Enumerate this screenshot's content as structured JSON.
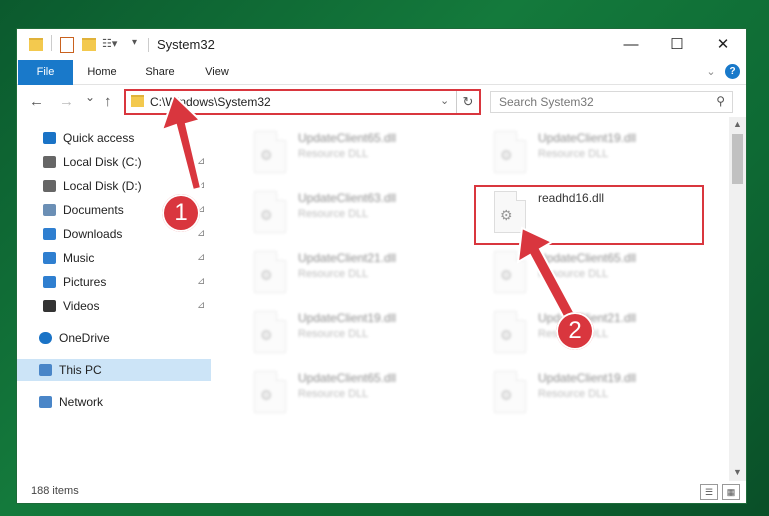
{
  "window": {
    "title": "System32",
    "controls": {
      "minimize": "—",
      "maximize": "☐",
      "close": "✕"
    }
  },
  "ribbon": {
    "tabs": [
      "File",
      "Home",
      "Share",
      "View"
    ],
    "expand_icon": "chevron-down-icon",
    "help_icon": "?"
  },
  "nav": {
    "back": "←",
    "forward": "→",
    "recent": "⌄",
    "up": "↑",
    "address": "C:\\Windows\\System32",
    "dropdown": "⌄",
    "refresh": "↻",
    "search_placeholder": "Search System32",
    "search_icon": "⚲"
  },
  "sidebar": {
    "items": [
      {
        "label": "Quick access",
        "icon": "star-icon",
        "pin": false
      },
      {
        "label": "Local Disk (C:)",
        "icon": "drive-icon",
        "pin": true
      },
      {
        "label": "Local Disk (D:)",
        "icon": "drive-icon",
        "pin": true
      },
      {
        "label": "Documents",
        "icon": "documents-icon",
        "pin": true
      },
      {
        "label": "Downloads",
        "icon": "download-icon",
        "pin": true
      },
      {
        "label": "Music",
        "icon": "music-icon",
        "pin": true
      },
      {
        "label": "Pictures",
        "icon": "pictures-icon",
        "pin": true
      },
      {
        "label": "Videos",
        "icon": "videos-icon",
        "pin": true
      },
      {
        "label": "OneDrive",
        "icon": "cloud-icon",
        "pin": false
      },
      {
        "label": "This PC",
        "icon": "computer-icon",
        "pin": false,
        "selected": true
      },
      {
        "label": "Network",
        "icon": "network-icon",
        "pin": false
      }
    ],
    "pin_glyph": "📌"
  },
  "files": {
    "left_column": [
      {
        "name": "UpdateClient65.dll",
        "type": "Resource DLL"
      },
      {
        "name": "UpdateClient63.dll",
        "type": "Resource DLL"
      },
      {
        "name": "UpdateClient21.dll",
        "type": "Resource DLL"
      },
      {
        "name": "UpdateClient19.dll",
        "type": "Resource DLL"
      },
      {
        "name": "UpdateClient65.dll",
        "type": "Resource DLL"
      }
    ],
    "right_column": [
      {
        "name": "UpdateClient19.dll",
        "type": "Resource DLL"
      },
      {
        "name": "readhd16.dll",
        "type": ""
      },
      {
        "name": "UpdateClient65.dll",
        "type": "Resource DLL"
      },
      {
        "name": "UpdateClient21.dll",
        "type": "Resource DLL"
      },
      {
        "name": "UpdateClient19.dll",
        "type": "Resource DLL"
      }
    ]
  },
  "status": {
    "item_count": "188 items"
  },
  "annotations": {
    "step1": "1",
    "step2": "2",
    "color": "#d9363e"
  }
}
